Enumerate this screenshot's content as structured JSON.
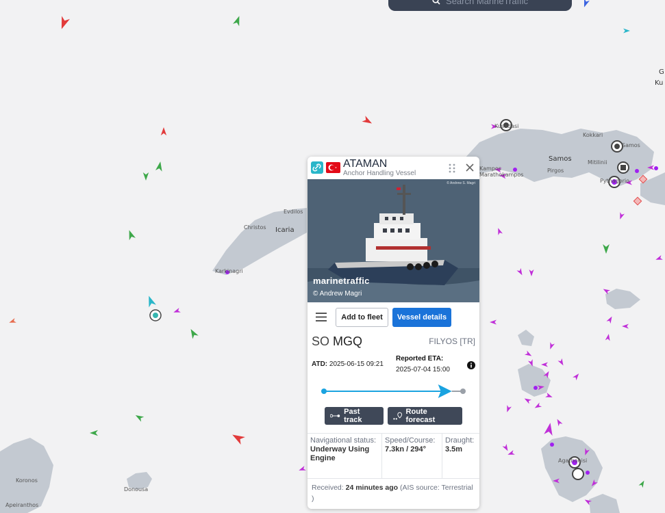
{
  "search": {
    "placeholder": "Search MarineTraffic"
  },
  "map": {
    "places": [
      "Evdilos",
      "Icaria",
      "Christos",
      "Karkinagri",
      "Kokkari",
      "Samos",
      "Mitilinii",
      "Pirgos",
      "Kampos Marathokampos",
      "Samos",
      "Pythagorio",
      "Agathonisi",
      "Donousa",
      "Koronos",
      "Apeiranthos",
      "Kusadasi",
      "G",
      "Ku"
    ]
  },
  "vessel": {
    "name": "ATAMAN",
    "type": "Anchor Handling Vessel",
    "flag": "TR",
    "photo_watermark": "marinetraffic",
    "photo_credit": "© Andrew Magri",
    "photo_tiny": "© Andrew S. Magri"
  },
  "actions": {
    "add_fleet": "Add to fleet",
    "vessel_details": "Vessel details",
    "past_track": "Past track",
    "route_forecast": "Route forecast"
  },
  "voyage": {
    "dest_prefix": "SO",
    "destination": "MGQ",
    "dest_port": "FILYOS [TR]",
    "atd_label": "ATD:",
    "atd_value": "2025-06-15 09:21",
    "eta_label": "Reported ETA:",
    "eta_value": "2025-07-04 15:00",
    "progress": 0.88
  },
  "stats": {
    "nav_label": "Navigational status:",
    "nav_value": "Underway Using Engine",
    "speed_label": "Speed/Course:",
    "speed_value": "7.3kn / 294°",
    "draught_label": "Draught:",
    "draught_value": "3.5m"
  },
  "received": {
    "label": "Received:",
    "value": "24 minutes ago",
    "source": "(AIS source: Terrestrial )"
  },
  "colors": {
    "accent": "#1a73d9",
    "dark_button": "#3f4858",
    "progress": "#1aa3e0",
    "land": "#c2c8d0",
    "sea": "#f2f2f3"
  }
}
